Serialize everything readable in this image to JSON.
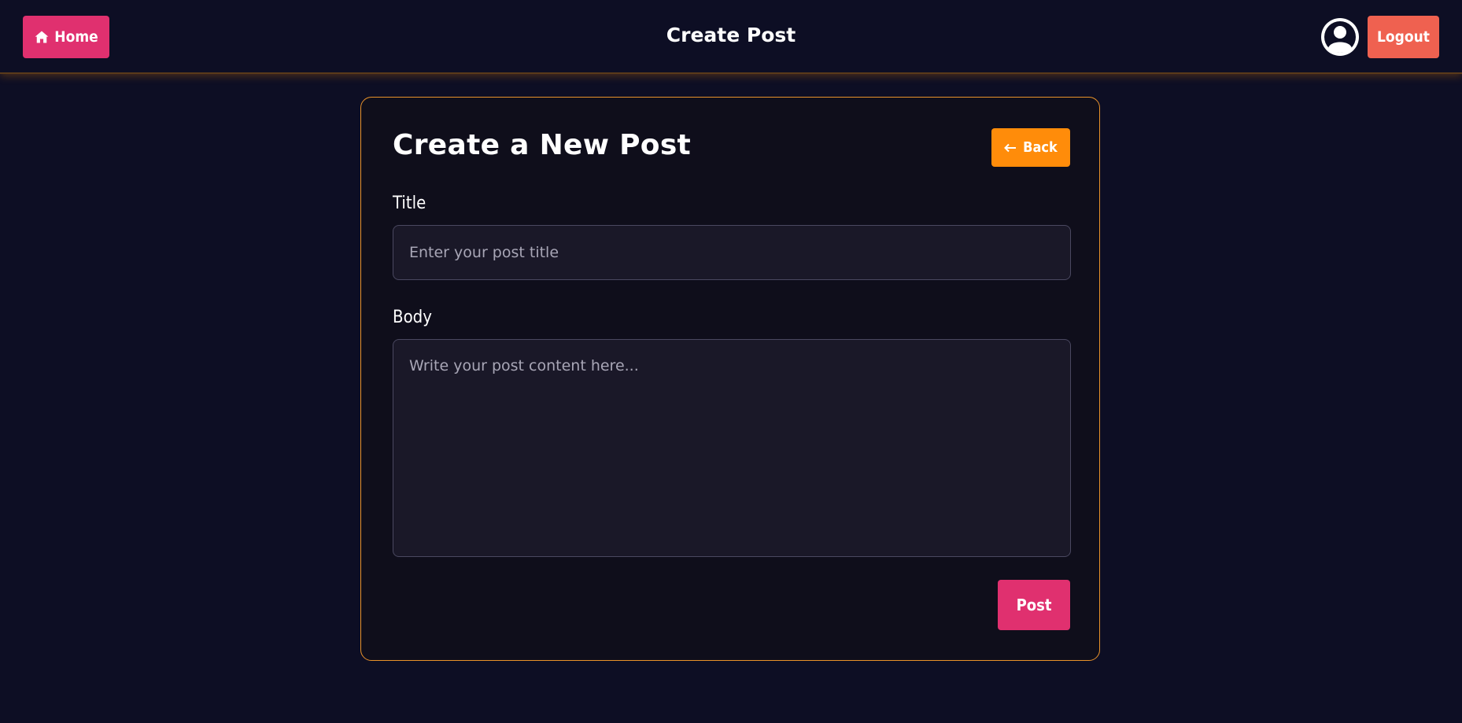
{
  "header": {
    "home_label": "Home",
    "home_icon": "home-icon",
    "page_title": "Create Post",
    "avatar_icon": "user-circle-icon",
    "logout_label": "Logout"
  },
  "form": {
    "heading": "Create a New Post",
    "back_label": "Back",
    "back_icon": "arrow-left-icon",
    "title_label": "Title",
    "title_placeholder": "Enter your post title",
    "title_value": "",
    "body_label": "Body",
    "body_placeholder": "Write your post content here...",
    "body_value": "",
    "submit_label": "Post"
  },
  "colors": {
    "background": "#0d0e24",
    "card_background": "#0f0e1b",
    "card_border": "#e8922a",
    "home_button": "#e0306f",
    "logout_button": "#ef6150",
    "back_button": "#ff8c0a",
    "post_button": "#e0306f",
    "input_background": "#1a1828"
  }
}
